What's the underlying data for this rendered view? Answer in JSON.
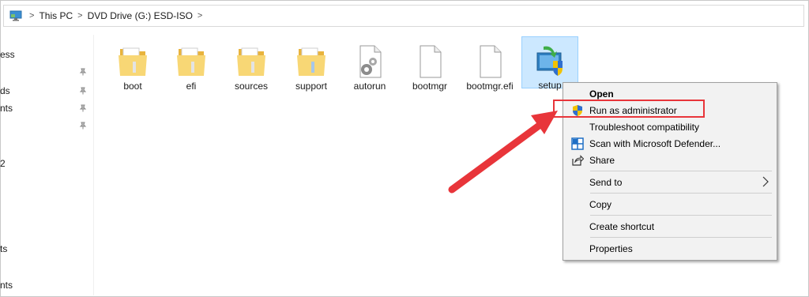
{
  "addressbar": {
    "path": [
      "This PC",
      "DVD Drive (G:) ESD-ISO"
    ],
    "separator": ">"
  },
  "navpane": {
    "items": [
      {
        "label": "ess",
        "pinned": false
      },
      {
        "label": "ds",
        "pinned": true
      },
      {
        "label": "nts",
        "pinned": true
      },
      {
        "label": "2",
        "pinned": false
      },
      {
        "label": "ts",
        "pinned": false
      },
      {
        "label": "nts",
        "pinned": false
      }
    ]
  },
  "files": [
    {
      "label": "boot",
      "icon": "folder-icon"
    },
    {
      "label": "efi",
      "icon": "folder-icon"
    },
    {
      "label": "sources",
      "icon": "folder-icon"
    },
    {
      "label": "support",
      "icon": "folder-icon"
    },
    {
      "label": "autorun",
      "icon": "settings-file-icon"
    },
    {
      "label": "bootmgr",
      "icon": "blank-file-icon"
    },
    {
      "label": "bootmgr.efi",
      "icon": "blank-file-icon"
    },
    {
      "label": "setup",
      "icon": "setup-installer-icon",
      "selected": true
    }
  ],
  "context_menu": {
    "items": [
      {
        "label": "Open",
        "bold": true
      },
      {
        "label": "Run as administrator",
        "icon": "uac-shield-icon"
      },
      {
        "label": "Troubleshoot compatibility"
      },
      {
        "label": "Scan with Microsoft Defender...",
        "icon": "defender-icon"
      },
      {
        "label": "Share",
        "icon": "share-icon"
      },
      {
        "label": "Send to",
        "submenu": true
      },
      {
        "label": "Copy"
      },
      {
        "label": "Create shortcut"
      },
      {
        "label": "Properties"
      }
    ]
  },
  "colors": {
    "highlight": "#e8353a",
    "selection": "#cce8ff",
    "folder": "#f5d26b"
  }
}
